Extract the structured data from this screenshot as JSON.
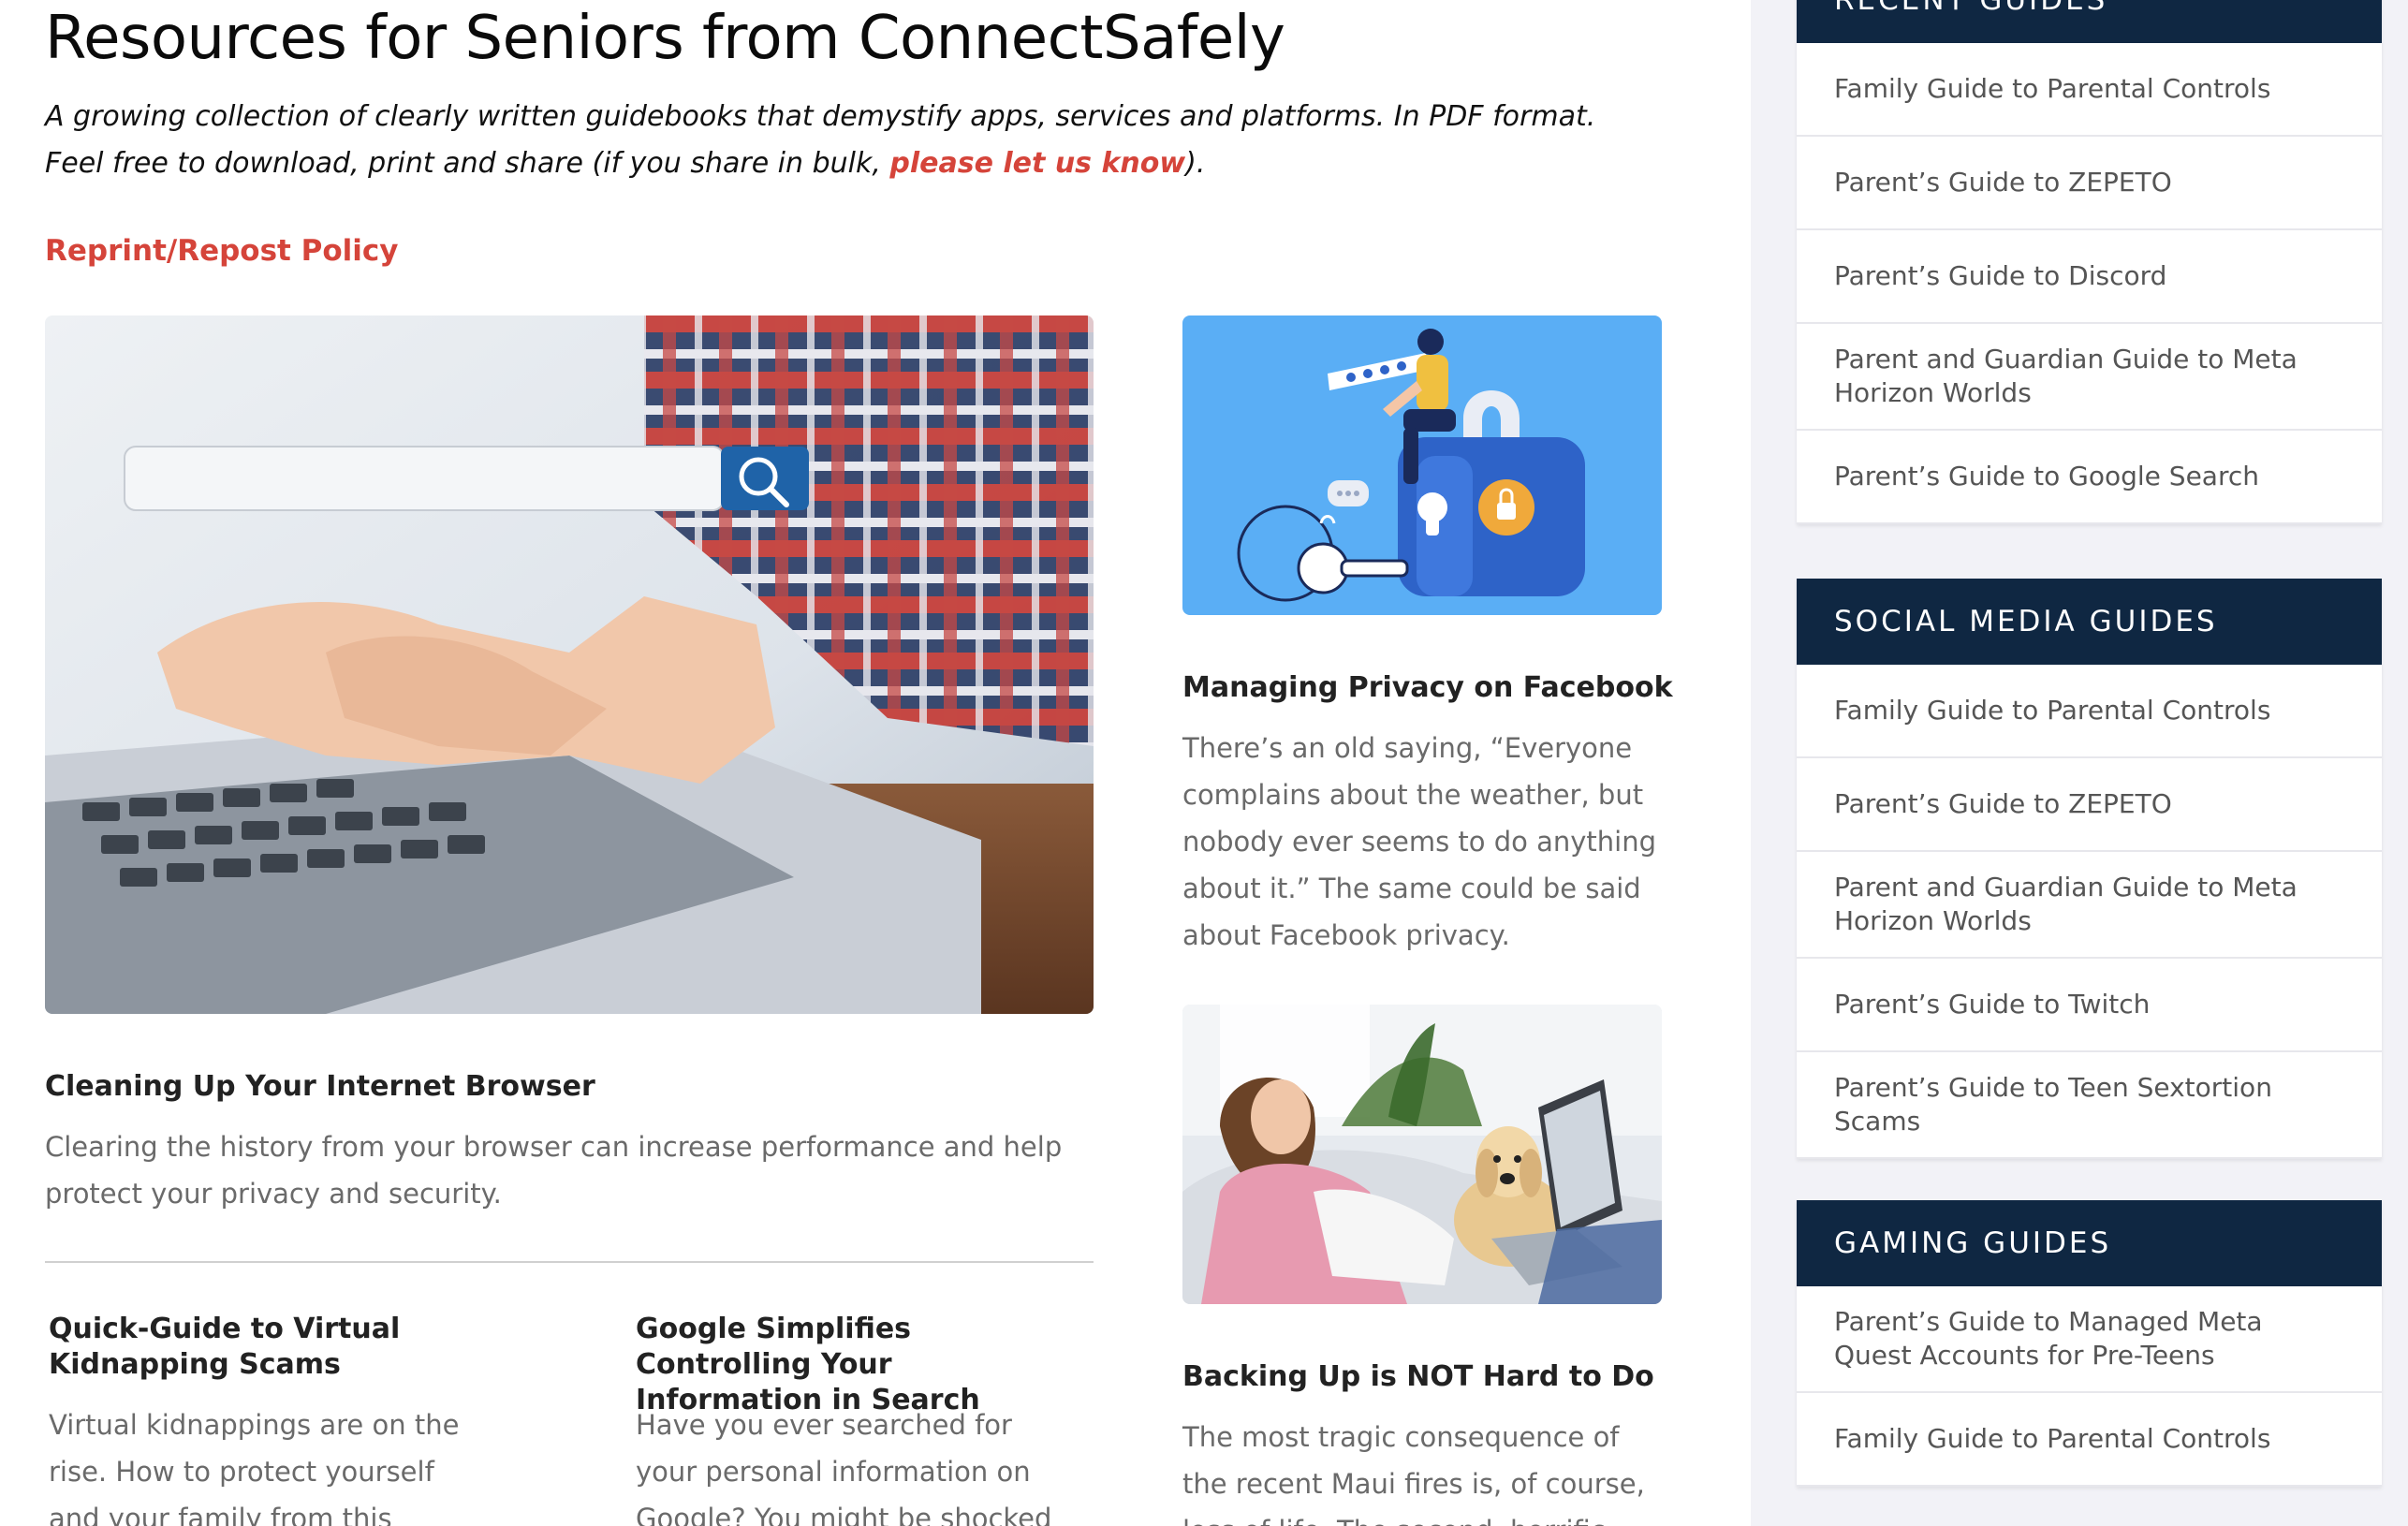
{
  "page": {
    "title": "Resources for Seniors from ConnectSafely",
    "intro_text": "A growing collection of clearly written guidebooks that demystify apps, services and platforms. In PDF format. Feel free to download, print and share (if you share in bulk, ",
    "intro_link": "please let us know",
    "intro_end": ").",
    "reprint_link": "Reprint/Repost Policy"
  },
  "articles": {
    "browser": {
      "title": "Cleaning Up Your Internet Browser",
      "excerpt": "Clearing the history from your browser can increase performance and help protect your privacy and security."
    },
    "facebook": {
      "title": "Managing Privacy on Facebook",
      "excerpt": "There’s an old saying, “Everyone complains about the weather, but nobody ever seems to do anything about it.” The same could be said about Facebook privacy."
    },
    "backup": {
      "title": "Backing Up is NOT Hard to Do",
      "excerpt": "The most tragic consequence of the recent Maui fires is, of course, loss of life. The second, horrific aspect"
    },
    "kidnapping": {
      "title": "Quick-Guide to Virtual Kidnapping Scams",
      "excerpt": "Virtual kidnappings are on the rise. How to protect yourself and your family from this terrifying"
    },
    "google": {
      "title": "Google Simplifies Controlling Your Information in Search",
      "excerpt": "Have you ever searched for your personal information on Google? You might be shocked by what"
    }
  },
  "sidebar": {
    "recent": {
      "header": "Recent Guides",
      "items": [
        "Family Guide to Parental Controls",
        "Parent’s Guide to ZEPETO",
        "Parent’s Guide to Discord",
        "Parent and Guardian Guide to Meta Horizon Worlds",
        "Parent’s Guide to Google Search"
      ]
    },
    "social": {
      "header": "Social Media Guides",
      "items": [
        "Family Guide to Parental Controls",
        "Parent’s Guide to ZEPETO",
        "Parent and Guardian Guide to Meta Horizon Worlds",
        "Parent’s Guide to Twitch",
        "Parent’s Guide to Teen Sextortion Scams"
      ]
    },
    "gaming": {
      "header": "Gaming Guides",
      "items": [
        "Parent’s Guide to Managed Meta Quest Accounts for Pre-Teens",
        "Family Guide to Parental Controls"
      ]
    }
  },
  "colors": {
    "accent_red": "#d5443a",
    "widget_header": "#0f2742",
    "sidebar_bg": "#f2f2f7",
    "facebook_image_bg": "#5aaef5"
  }
}
